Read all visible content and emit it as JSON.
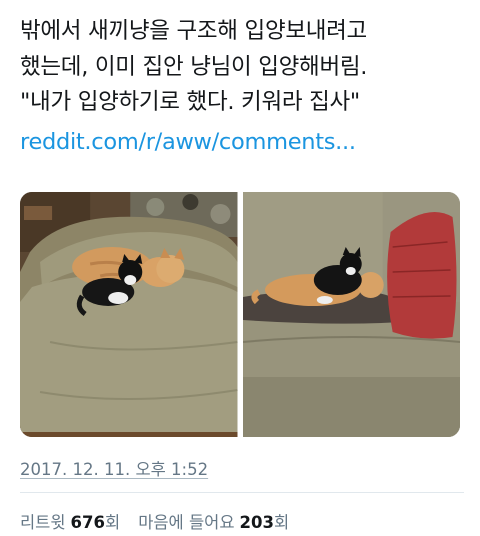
{
  "tweet": {
    "text_lines": [
      "밖에서 새끼냥을 구조해 입양보내려고",
      "했는데, 이미 집안 냥님이 입양해버림.",
      "\"내가 입양하기로 했다. 키워라 집사\""
    ],
    "link": "reddit.com/r/aww/comments..."
  },
  "media": {
    "photos": [
      {
        "alt_icon": "cat-photo-1"
      },
      {
        "alt_icon": "cat-photo-2"
      }
    ]
  },
  "timestamp": "2017. 12. 11. 오후 1:52",
  "stats": {
    "retweets": {
      "label": "리트윗",
      "count": "676",
      "suffix": "회"
    },
    "likes": {
      "label": "마음에 들어요",
      "count": "203",
      "suffix": "회"
    }
  },
  "colors": {
    "text": "#14171a",
    "link": "#1b95e0",
    "muted": "#657786",
    "divider": "#e1e8ed"
  }
}
